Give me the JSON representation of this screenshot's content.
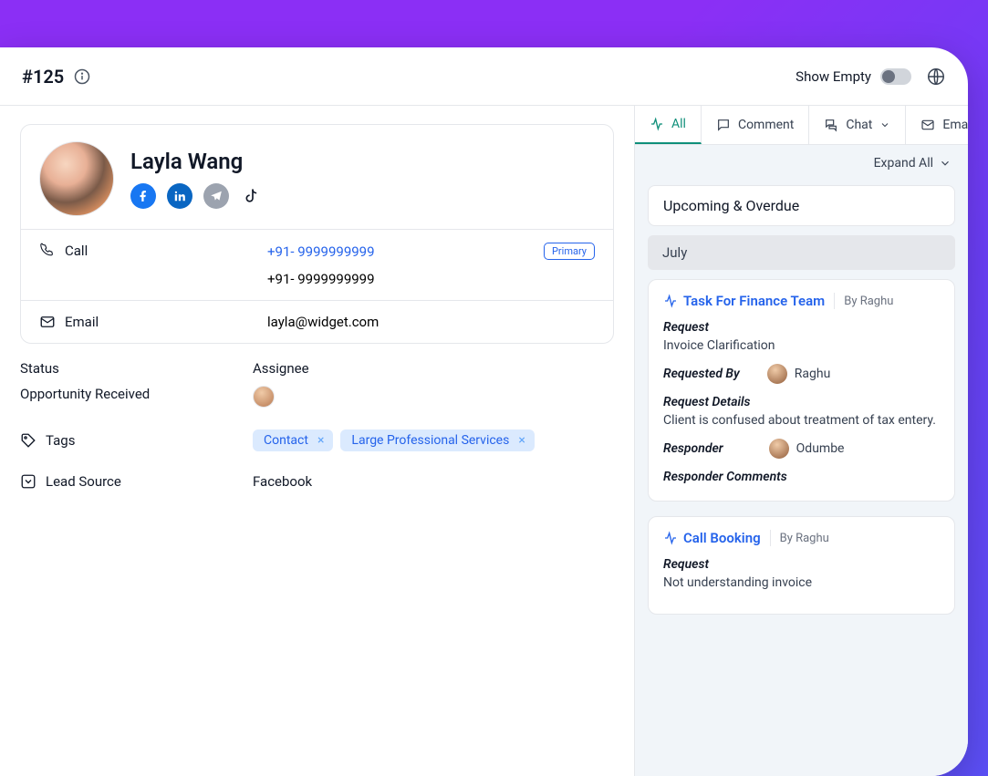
{
  "header": {
    "ticket_id": "#125",
    "show_empty_label": "Show Empty"
  },
  "contact": {
    "name": "Layla Wang",
    "call_label": "Call",
    "phones": [
      "+91- 9999999999",
      "+91- 9999999999"
    ],
    "primary_badge": "Primary",
    "email_label": "Email",
    "email": "layla@widget.com"
  },
  "fields": {
    "status_label": "Status",
    "status_value": "Opportunity Received",
    "assignee_label": "Assignee",
    "tags_label": "Tags",
    "tags": [
      "Contact",
      "Large Professional Services"
    ],
    "lead_source_label": "Lead Source",
    "lead_source_value": "Facebook"
  },
  "timeline": {
    "tabs": {
      "all": "All",
      "comment": "Comment",
      "chat": "Chat",
      "email": "Email"
    },
    "expand_all": "Expand All",
    "upcoming": "Upcoming & Overdue",
    "month": "July",
    "activities": [
      {
        "title": "Task For Finance Team",
        "by": "By Raghu",
        "request_label": "Request",
        "request_value": "Invoice Clarification",
        "requested_by_label": "Requested By",
        "requested_by_name": "Raghu",
        "request_details_label": "Request Details",
        "request_details_value": "Client is confused about treatment of tax entery.",
        "responder_label": "Responder",
        "responder_name": "Odumbe",
        "responder_comments_label": "Responder Comments"
      },
      {
        "title": "Call Booking",
        "by": "By Raghu",
        "request_label": "Request",
        "request_value": "Not understanding invoice"
      }
    ]
  }
}
